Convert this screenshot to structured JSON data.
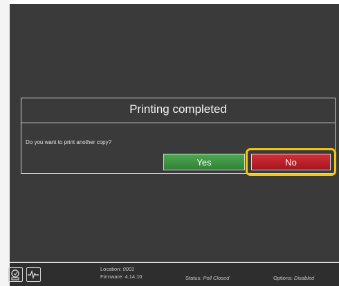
{
  "dialog": {
    "title": "Printing completed",
    "message": "Do you want to print another copy?",
    "yes_label": "Yes",
    "no_label": "No"
  },
  "status_bar": {
    "location_label": "Location:",
    "location_value": "0001",
    "firmware_label": "Firmware:",
    "firmware_value": "4.14.10",
    "status_label": "Status:",
    "status_value": "Poll Closed",
    "options_label": "Options:",
    "options_value": "Disabled"
  },
  "icons": {
    "left": "printer-settings-icon",
    "right": "heartbeat-monitor-icon"
  },
  "colors": {
    "background": "#3a3a3a",
    "yes_button": "#2f8434",
    "no_button": "#a8141d",
    "highlight": "#f3c80e"
  }
}
